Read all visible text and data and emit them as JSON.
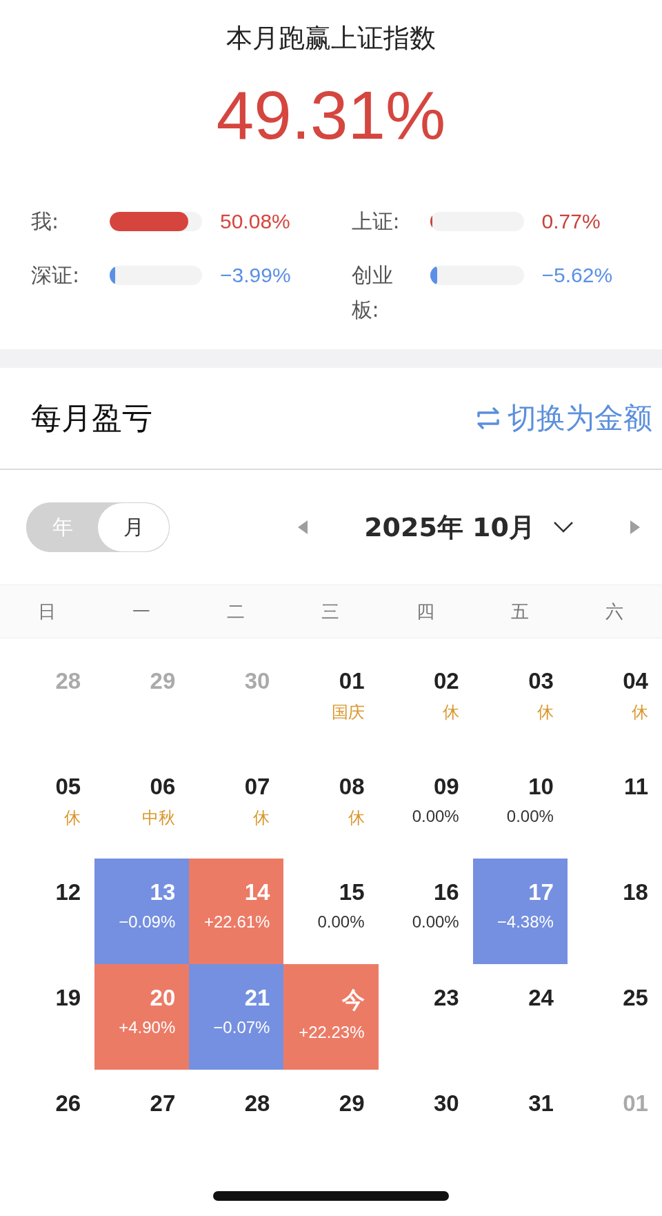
{
  "summary": {
    "title": "本月跑赢上证指数",
    "value": "49.31%"
  },
  "metrics": [
    {
      "label": "我:",
      "level": 0.85,
      "color": "#d6453d",
      "value": "50.08%"
    },
    {
      "label": "上证:",
      "level": 0.01,
      "color": "#c7423b",
      "value": "0.77%"
    },
    {
      "label": "深证:",
      "level": 0.06,
      "color": "#5b8fe6",
      "value": "−3.99%"
    },
    {
      "label": "创业板:",
      "level": 0.08,
      "color": "#5b8fe6",
      "value": "−5.62%"
    }
  ],
  "section": {
    "title": "每月盈亏",
    "switch_label": "切换为金额"
  },
  "period_toggle": [
    {
      "label": "年",
      "selected": false
    },
    {
      "label": "月",
      "selected": true
    }
  ],
  "month_nav": {
    "title": "2025年 10月"
  },
  "weekdays": [
    "日",
    "一",
    "二",
    "三",
    "四",
    "五",
    "六"
  ],
  "weeks": [
    [
      {
        "day": "28",
        "kind": "outside"
      },
      {
        "day": "29",
        "kind": "outside"
      },
      {
        "day": "30",
        "kind": "outside"
      },
      {
        "day": "01",
        "kind": "holiday",
        "note": "国庆"
      },
      {
        "day": "02",
        "kind": "holiday",
        "note": "休"
      },
      {
        "day": "03",
        "kind": "holiday",
        "note": "休"
      },
      {
        "day": "04",
        "kind": "holiday",
        "note": "休"
      }
    ],
    [
      {
        "day": "05",
        "kind": "holiday",
        "note": "休"
      },
      {
        "day": "06",
        "kind": "holiday",
        "note": "中秋"
      },
      {
        "day": "07",
        "kind": "holiday",
        "note": "休"
      },
      {
        "day": "08",
        "kind": "holiday",
        "note": "休"
      },
      {
        "day": "09",
        "kind": "plain",
        "note": "0.00%"
      },
      {
        "day": "10",
        "kind": "plain",
        "note": "0.00%"
      },
      {
        "day": "11",
        "kind": "plain"
      }
    ],
    [
      {
        "day": "12",
        "kind": "plain"
      },
      {
        "day": "13",
        "kind": "down",
        "note": "−0.09%"
      },
      {
        "day": "14",
        "kind": "up",
        "note": "+22.61%"
      },
      {
        "day": "15",
        "kind": "plain",
        "note": "0.00%"
      },
      {
        "day": "16",
        "kind": "plain",
        "note": "0.00%"
      },
      {
        "day": "17",
        "kind": "down",
        "note": "−4.38%"
      },
      {
        "day": "18",
        "kind": "plain"
      }
    ],
    [
      {
        "day": "19",
        "kind": "plain"
      },
      {
        "day": "20",
        "kind": "up",
        "note": "+4.90%"
      },
      {
        "day": "21",
        "kind": "down",
        "note": "−0.07%"
      },
      {
        "day": "今",
        "kind": "up",
        "note": "+22.23%"
      },
      {
        "day": "23",
        "kind": "plain"
      },
      {
        "day": "24",
        "kind": "plain"
      },
      {
        "day": "25",
        "kind": "plain"
      }
    ],
    [
      {
        "day": "26",
        "kind": "plain"
      },
      {
        "day": "27",
        "kind": "plain"
      },
      {
        "day": "28",
        "kind": "plain"
      },
      {
        "day": "29",
        "kind": "plain"
      },
      {
        "day": "30",
        "kind": "plain"
      },
      {
        "day": "31",
        "kind": "plain"
      },
      {
        "day": "01",
        "kind": "outside"
      }
    ]
  ]
}
